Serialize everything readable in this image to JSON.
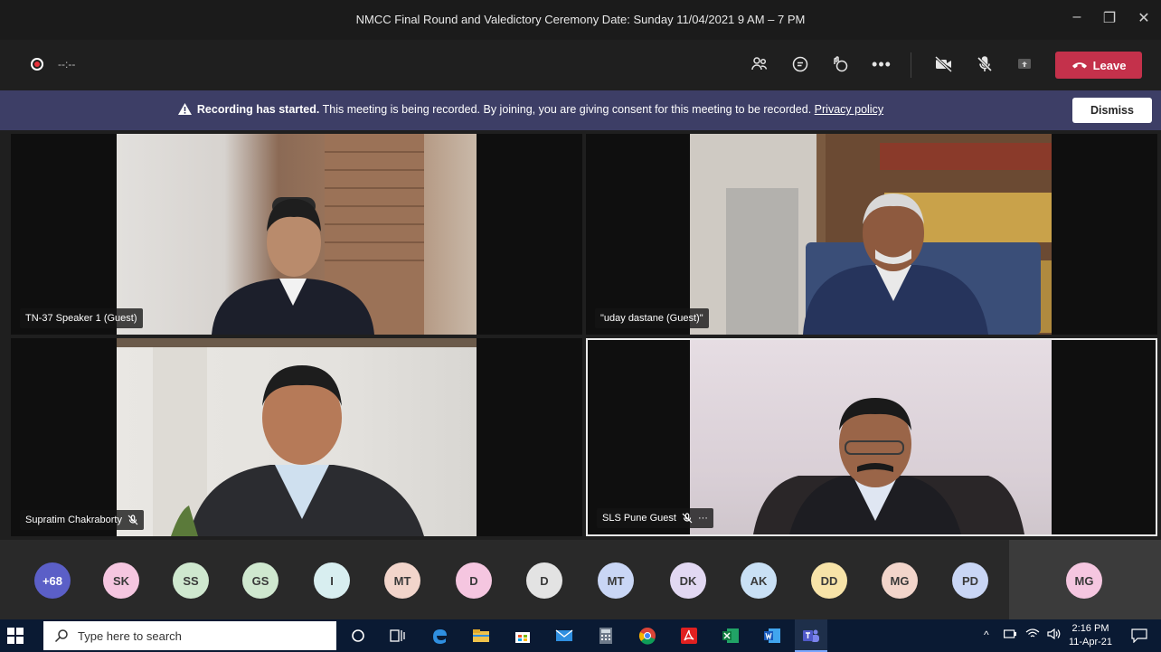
{
  "window": {
    "title": "NMCC Final Round and Valedictory Ceremony Date: Sunday 11/04/2021 9 AM – 7 PM",
    "minimize": "–",
    "maximize": "❐",
    "close": "✕"
  },
  "toolbar": {
    "recording_time": "--:--",
    "leave_label": "Leave"
  },
  "banner": {
    "bold": "Recording has started.",
    "message": "This meeting is being recorded. By joining, you are giving consent for this meeting to be recorded.",
    "link": "Privacy policy",
    "dismiss_label": "Dismiss"
  },
  "tiles": [
    {
      "name": "TN-37 Speaker 1 (Guest)",
      "muted": false
    },
    {
      "name": "\"uday dastane (Guest)\"",
      "muted": false
    },
    {
      "name": "Supratim Chakraborty",
      "muted": true
    },
    {
      "name": "SLS Pune Guest",
      "muted": true,
      "more": "···"
    }
  ],
  "participants": [
    {
      "initials": "+68",
      "color": "#5b5fc7"
    },
    {
      "initials": "SK",
      "color": "#f5c6e0"
    },
    {
      "initials": "SS",
      "color": "#cfe8cf"
    },
    {
      "initials": "GS",
      "color": "#cfe8cf"
    },
    {
      "initials": "I",
      "color": "#d8eef0"
    },
    {
      "initials": "MT",
      "color": "#f2d5cb"
    },
    {
      "initials": "D",
      "color": "#f5c6e0"
    },
    {
      "initials": "D",
      "color": "#e3e3e3"
    },
    {
      "initials": "MT",
      "color": "#c9d6f5"
    },
    {
      "initials": "DK",
      "color": "#e2d8f2"
    },
    {
      "initials": "AK",
      "color": "#c9e0f5"
    },
    {
      "initials": "DD",
      "color": "#f7e3a8"
    },
    {
      "initials": "MG",
      "color": "#f2d5cb"
    },
    {
      "initials": "PD",
      "color": "#c9d6f5"
    },
    {
      "initials": "MG",
      "color": "#f5c6e0"
    }
  ],
  "taskbar": {
    "search_placeholder": "Type here to search",
    "time": "2:16 PM",
    "date": "11-Apr-21"
  }
}
